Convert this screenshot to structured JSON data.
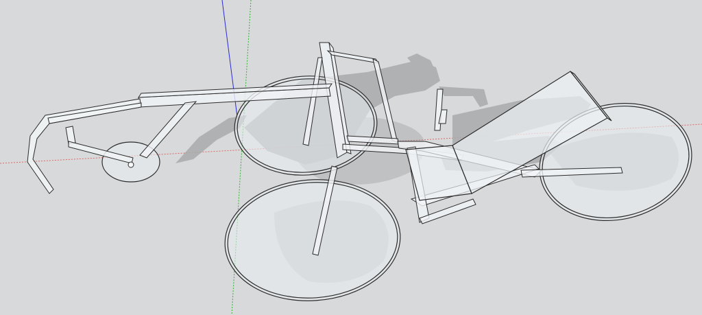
{
  "viewport": {
    "background": "#d8d9da",
    "axis_colors": {
      "red": "#e05555",
      "green": "#2fb02f",
      "blue": "#2a2ad8"
    },
    "model_colors": {
      "edge": "#2b2b2b",
      "glass": "#e9eef2",
      "shadow": "#a9aaab"
    },
    "scene_description_items": [
      "axes",
      "shadow",
      "wheels",
      "frame",
      "seat",
      "boom",
      "pedals",
      "handlebar"
    ]
  }
}
